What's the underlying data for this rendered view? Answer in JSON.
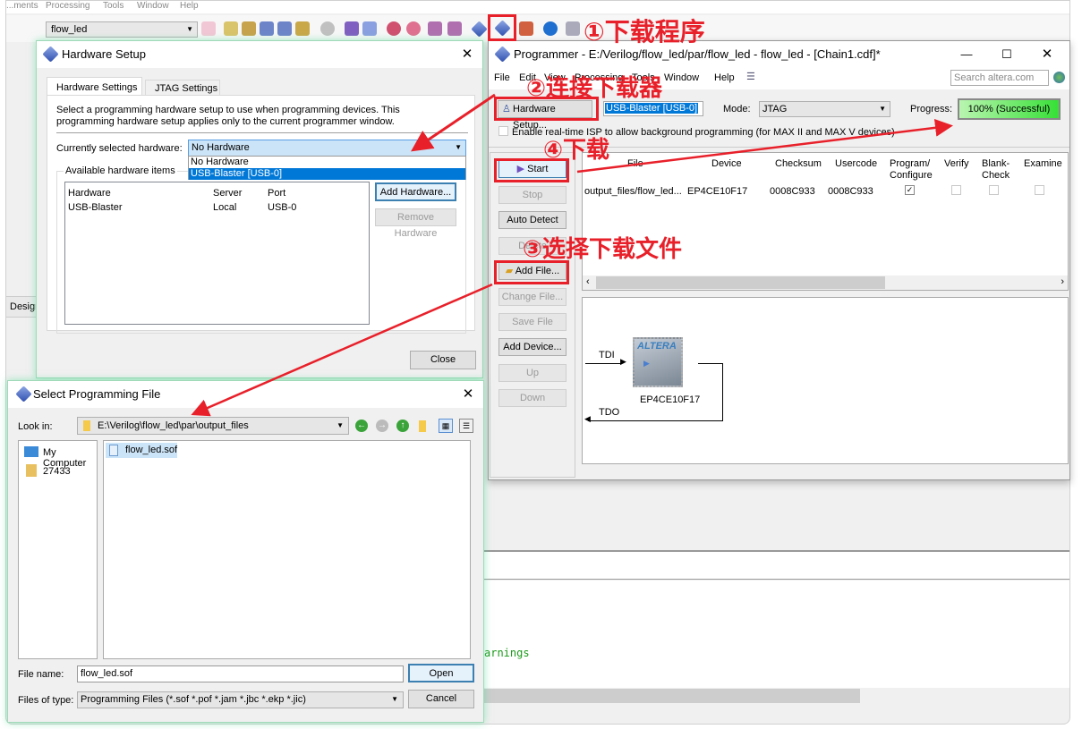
{
  "main": {
    "menu": [
      "...ments",
      "Processing",
      "Tools",
      "Window",
      "Help"
    ],
    "project_select": "flow_led",
    "design_tab": "Design",
    "messages_fragment": "arnings"
  },
  "annotations": {
    "step1": "①下载程序",
    "step2": "②连接下载器",
    "step3": "③选择下载文件",
    "step4": "④下载",
    "color": "#e8202a"
  },
  "hardware_setup": {
    "title": "Hardware Setup",
    "tabs": [
      "Hardware Settings",
      "JTAG Settings"
    ],
    "active_tab": 0,
    "description": "Select a programming hardware setup to use when programming devices. This programming hardware setup applies only to the current programmer window.",
    "selected_label": "Currently selected hardware:",
    "selected_value": "No Hardware",
    "dropdown_options": [
      "No Hardware",
      "USB-Blaster [USB-0]"
    ],
    "highlighted_option": 1,
    "available_label": "Available hardware items",
    "columns": [
      "Hardware",
      "Server",
      "Port"
    ],
    "rows": [
      [
        "USB-Blaster",
        "Local",
        "USB-0"
      ]
    ],
    "add_button": "Add Hardware...",
    "remove_button": "Remove Hardware",
    "close_button": "Close"
  },
  "programmer": {
    "title": "Programmer - E:/Verilog/flow_led/par/flow_led - flow_led - [Chain1.cdf]*",
    "menu": [
      "File",
      "Edit",
      "View",
      "Processing",
      "Tools",
      "Window",
      "Help"
    ],
    "search_placeholder": "Search altera.com",
    "hardware_setup_button": "Hardware Setup...",
    "hardware_value": "USB-Blaster [USB-0]",
    "mode_label": "Mode:",
    "mode_value": "JTAG",
    "progress_label": "Progress:",
    "progress_text": "100% (Successful)",
    "progress_percent": 100,
    "progress_color": "#5fe85f",
    "isp_checkbox": "Enable real-time ISP to allow background programming (for MAX II and MAX V devices)",
    "side_buttons": [
      {
        "label": "Start",
        "enabled": true
      },
      {
        "label": "Stop",
        "enabled": false
      },
      {
        "label": "Auto Detect",
        "enabled": true
      },
      {
        "label": "Delete",
        "enabled": false
      },
      {
        "label": "Add File...",
        "enabled": true
      },
      {
        "label": "Change File...",
        "enabled": false
      },
      {
        "label": "Save File",
        "enabled": false
      },
      {
        "label": "Add Device...",
        "enabled": true
      },
      {
        "label": "Up",
        "enabled": false
      },
      {
        "label": "Down",
        "enabled": false
      }
    ],
    "columns": [
      "File",
      "Device",
      "Checksum",
      "Usercode",
      "Program/ Configure",
      "Verify",
      "Blank- Check",
      "Examine"
    ],
    "rows": [
      {
        "file": "output_files/flow_led...",
        "device": "EP4CE10F17",
        "checksum": "0008C933",
        "usercode": "0008C933",
        "program": true,
        "verify": false,
        "blank": false,
        "examine": false
      }
    ],
    "chain": {
      "tdi": "TDI",
      "tdo": "TDO",
      "device": "EP4CE10F17",
      "logo": "ALTERA"
    }
  },
  "file_dialog": {
    "title": "Select Programming File",
    "look_in_label": "Look in:",
    "look_in_value": "E:\\Verilog\\flow_led\\par\\output_files",
    "places": [
      "My Computer",
      "27433"
    ],
    "files": [
      "flow_led.sof"
    ],
    "file_name_label": "File name:",
    "file_name_value": "flow_led.sof",
    "file_type_label": "Files of type:",
    "file_type_value": "Programming Files (*.sof *.pof *.jam *.jbc *.ekp *.jic)",
    "open_button": "Open",
    "cancel_button": "Cancel"
  }
}
